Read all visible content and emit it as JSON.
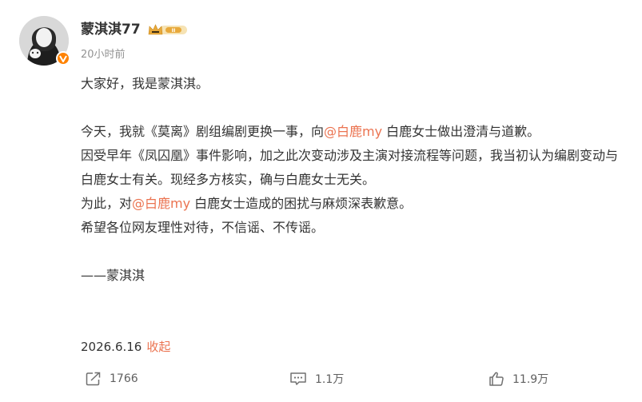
{
  "post": {
    "username": "蒙淇淇77",
    "vip_badge_icon": "vip-crown-badge-icon",
    "timestamp": "20小时前",
    "greeting": "大家好，我是蒙淇淇。",
    "p1_before": "今天，我就《莫离》剧组编剧更换一事，向",
    "mention": "@白鹿my",
    "p1_after": " 白鹿女士做出澄清与道歉。",
    "p2": "因受早年《凤囚凰》事件影响，加之此次变动涉及主演对接流程等问题，我当初认为编剧变动与白鹿女士有关。现经多方核实，确与白鹿女士无关。",
    "p3_before": "为此，对",
    "p3_after": " 白鹿女士造成的困扰与麻烦深表歉意。",
    "p4": "希望各位网友理性对待，不信谣、不传谣。",
    "signature": "——蒙淇淇",
    "date": "2026.6.16",
    "collapse_label": "收起"
  },
  "actions": {
    "repost_count": "1766",
    "comment_count": "1.1万",
    "like_count": "11.9万"
  },
  "colors": {
    "mention": "#eb7350",
    "verified_badge": "#ff8200",
    "vip_gold": "#e8a93b"
  }
}
